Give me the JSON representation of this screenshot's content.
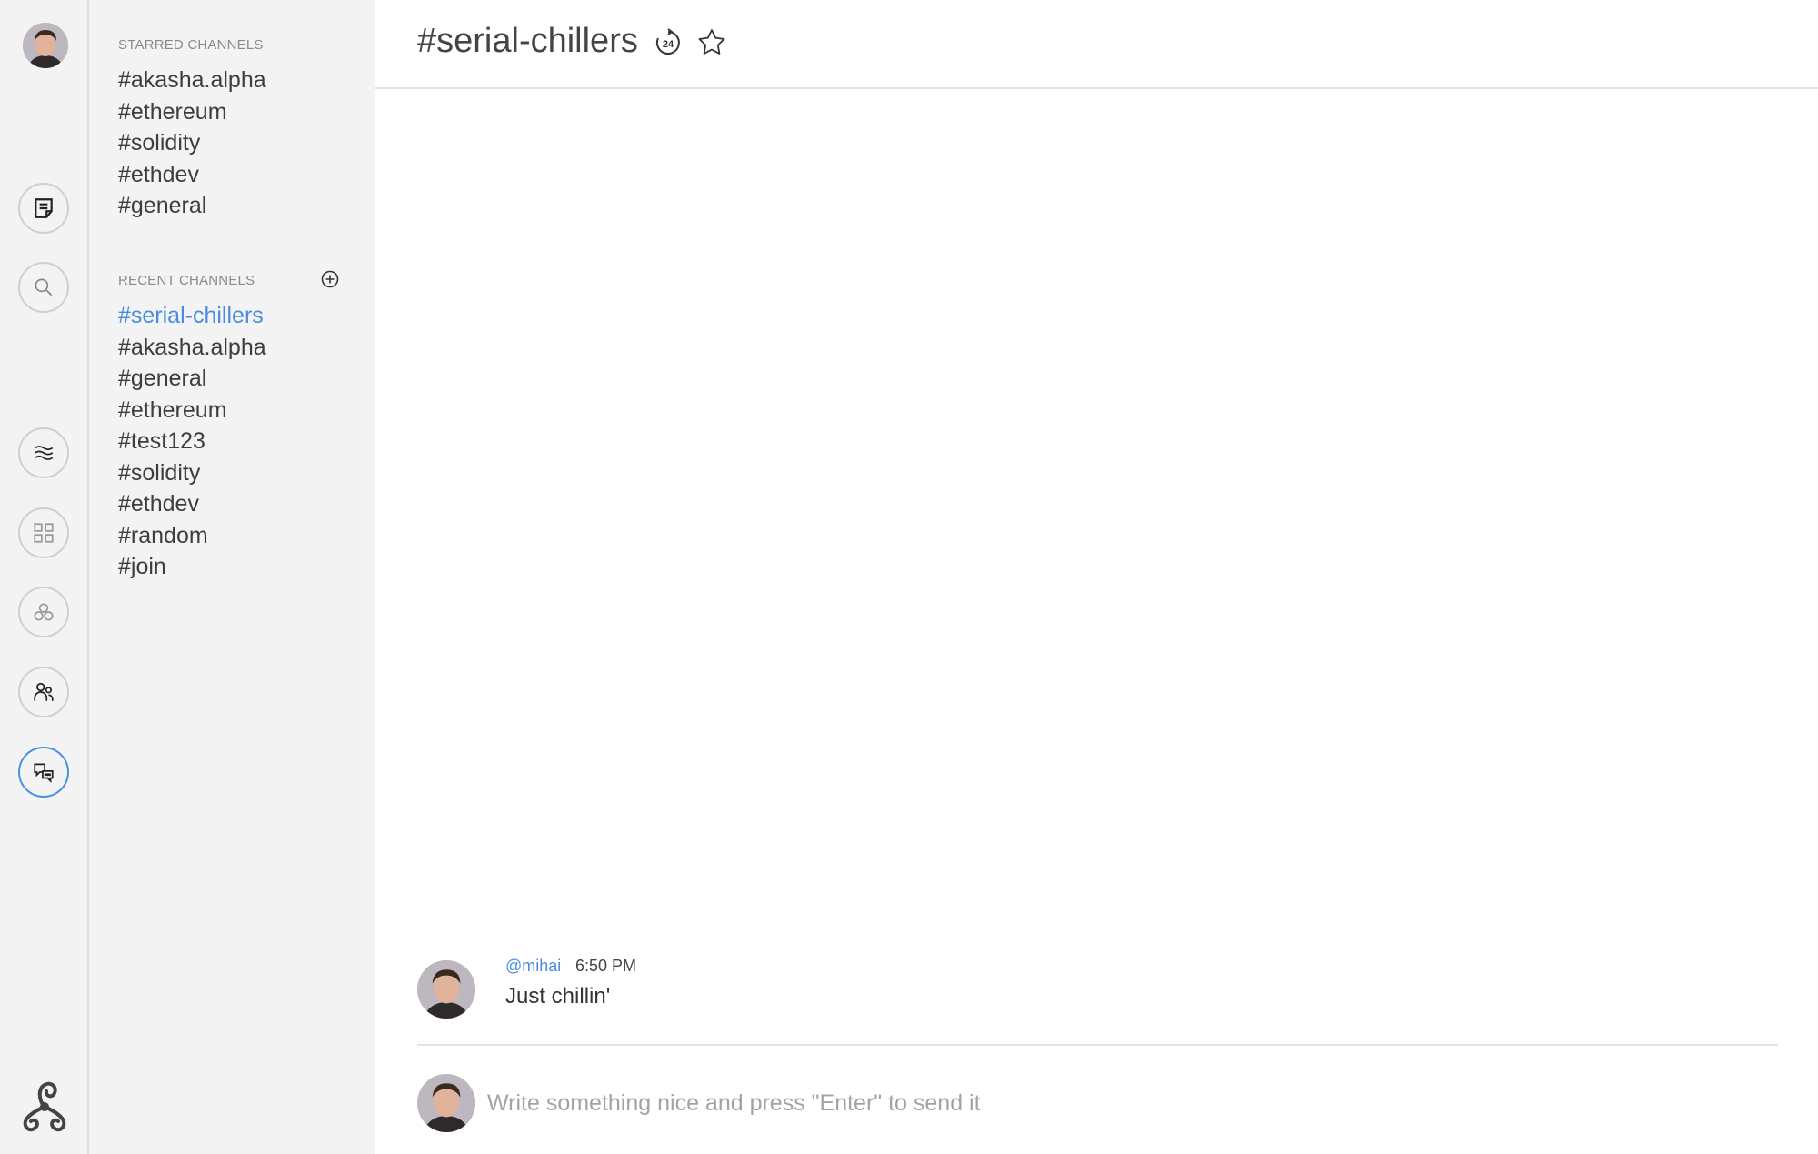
{
  "user": {
    "avatar_alt": "user avatar"
  },
  "nav": {
    "items": [
      {
        "name": "notes",
        "icon": "note-icon"
      },
      {
        "name": "search",
        "icon": "search-icon"
      },
      {
        "name": "stream",
        "icon": "waves-icon"
      },
      {
        "name": "dashboard",
        "icon": "grid-icon"
      },
      {
        "name": "communities",
        "icon": "circles-icon"
      },
      {
        "name": "people",
        "icon": "people-icon"
      },
      {
        "name": "chat",
        "icon": "chat-bubbles-icon",
        "active": true
      }
    ],
    "logo": "triskelion-logo-icon"
  },
  "channels": {
    "starred_title": "STARRED CHANNELS",
    "starred": [
      "#akasha.alpha",
      "#ethereum",
      "#solidity",
      "#ethdev",
      "#general"
    ],
    "recent_title": "RECENT CHANNELS",
    "recent": [
      "#serial-chillers",
      "#akasha.alpha",
      "#general",
      "#ethereum",
      "#test123",
      "#solidity",
      "#ethdev",
      "#random",
      "#join"
    ],
    "active": "#serial-chillers",
    "accent_color": "#4a8be0"
  },
  "header": {
    "title": "#serial-chillers",
    "history_icon": "24h-history-icon",
    "star_icon": "star-outline-icon"
  },
  "messages": [
    {
      "user": "@mihai",
      "time": "6:50 PM",
      "text": "Just chillin'"
    }
  ],
  "composer": {
    "placeholder": "Write something nice and press \"Enter\" to send it",
    "value": ""
  }
}
